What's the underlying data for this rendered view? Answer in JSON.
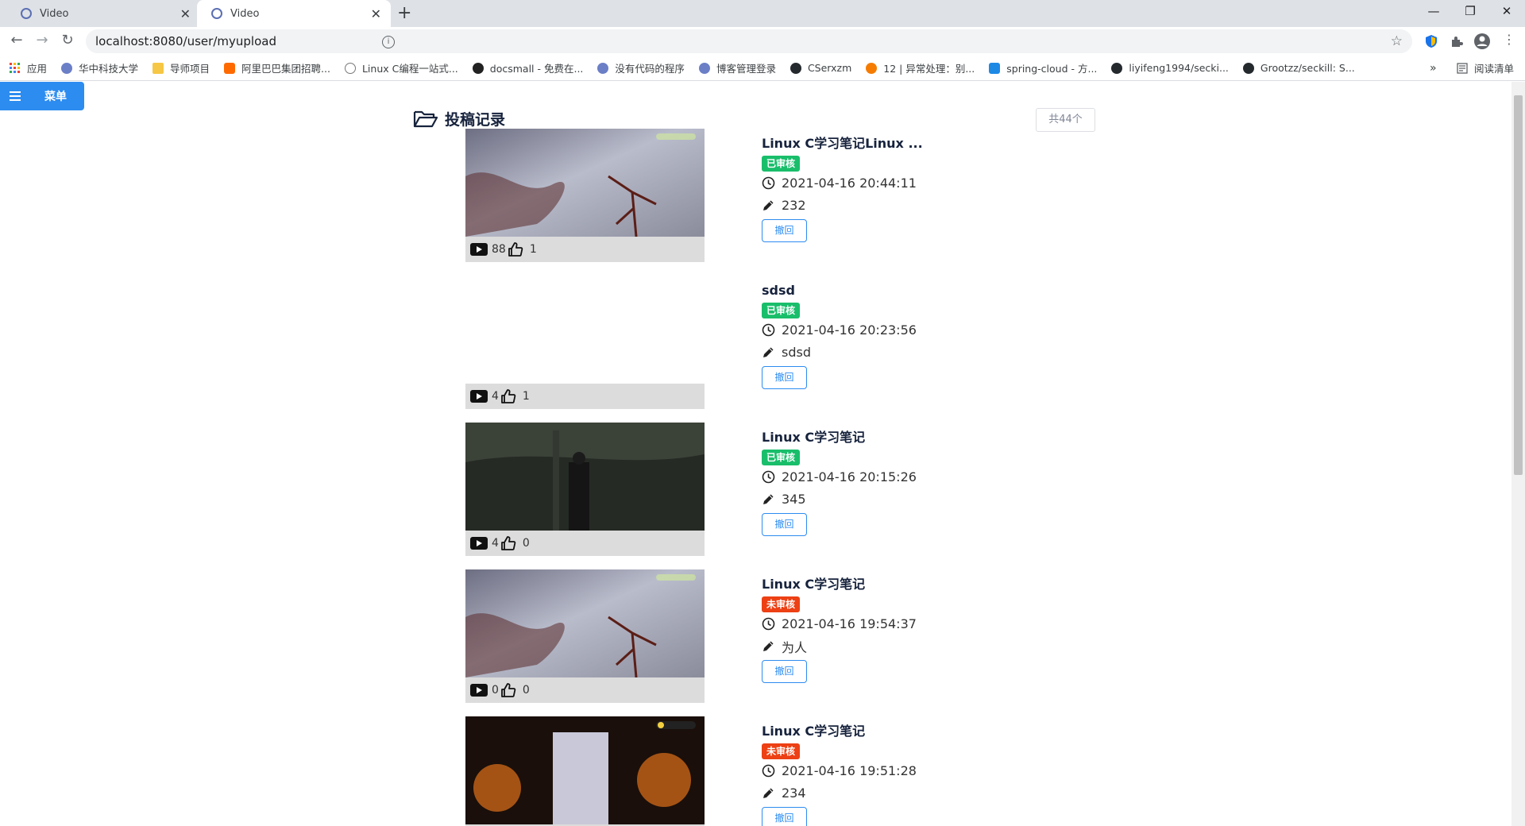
{
  "browser": {
    "tabs": [
      {
        "title": "Video"
      },
      {
        "title": "Video"
      }
    ],
    "url": "localhost:8080/user/myupload",
    "bookmarks": [
      "应用",
      "华中科技大学",
      "导师项目",
      "阿里巴巴集团招聘...",
      "Linux C编程一站式...",
      "docsmall - 免费在...",
      "没有代码的程序",
      "博客管理登录",
      "CSerxzm",
      "12 | 异常处理：别...",
      "spring-cloud - 方...",
      "liyifeng1994/secki...",
      "Grootzz/seckill: S..."
    ],
    "reading_list": "阅读清单",
    "more": "»"
  },
  "page": {
    "menu_label": "菜单",
    "heading": "投稿记录",
    "total": "共44个",
    "withdraw_label": "撤回",
    "items": [
      {
        "title": "Linux C学习笔记Linux ...",
        "status": "已审核",
        "approved": true,
        "time": "2021-04-16 20:44:11",
        "desc": "232",
        "views": "88",
        "likes": "1",
        "thumb": "frost"
      },
      {
        "title": "sdsd",
        "status": "已审核",
        "approved": true,
        "time": "2021-04-16 20:23:56",
        "desc": "sdsd",
        "views": "4",
        "likes": "1",
        "thumb": "none"
      },
      {
        "title": "Linux C学习笔记",
        "status": "已审核",
        "approved": true,
        "time": "2021-04-16 20:15:26",
        "desc": "345",
        "views": "4",
        "likes": "0",
        "thumb": "dark"
      },
      {
        "title": "Linux C学习笔记",
        "status": "未审核",
        "approved": false,
        "time": "2021-04-16 19:54:37",
        "desc": "为人",
        "views": "0",
        "likes": "0",
        "thumb": "frost"
      },
      {
        "title": "Linux C学习笔记",
        "status": "未审核",
        "approved": false,
        "time": "2021-04-16 19:51:28",
        "desc": "234",
        "views": "",
        "likes": "",
        "thumb": "stage"
      }
    ]
  },
  "colors": {
    "primary": "#2d8cf0",
    "approved": "#19be6b",
    "pending": "#ed4014"
  }
}
